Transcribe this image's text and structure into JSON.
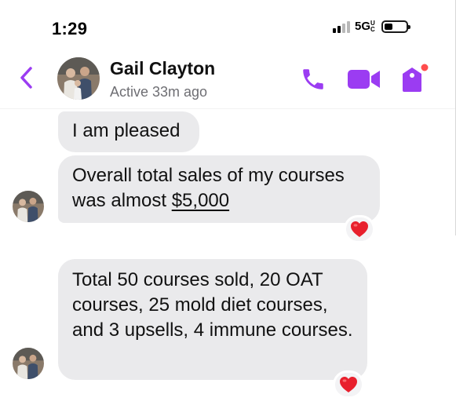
{
  "status_bar": {
    "time": "1:29",
    "network": "5G",
    "network_suffix": "UC"
  },
  "header": {
    "contact_name": "Gail Clayton",
    "contact_status": "Active 33m ago",
    "accent_color": "#9b3cf2",
    "notification_dot_color": "#ff4d4d",
    "icons": [
      "back-chevron-icon",
      "phone-icon",
      "video-camera-icon",
      "tag-icon"
    ]
  },
  "messages": [
    {
      "text": "I am pleased"
    },
    {
      "text_before": "Overall total sales of my courses was almost ",
      "link_text": "$5,000",
      "reaction": "❤️"
    },
    {
      "text": "Total 50 courses sold, 20 OAT courses, 25 mold diet courses, and 3 upsells, 4 immune courses.",
      "reaction": "❤️"
    }
  ]
}
